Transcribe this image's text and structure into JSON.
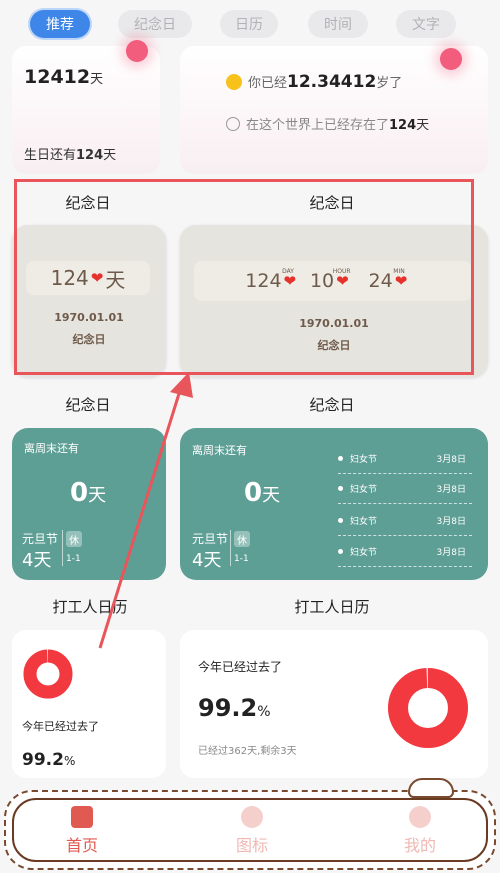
{
  "tabs": [
    {
      "label": "推荐",
      "active": true
    },
    {
      "label": "纪念日",
      "active": false
    },
    {
      "label": "日历",
      "active": false
    },
    {
      "label": "时间",
      "active": false
    },
    {
      "label": "文字",
      "active": false
    }
  ],
  "top_left_card": {
    "days_value": "12412",
    "days_unit": "天",
    "birthday_prefix": "生日还有",
    "birthday_value": "124",
    "birthday_unit": "天"
  },
  "top_right_card": {
    "age_prefix": "你已经",
    "age_value": "12.34412",
    "age_unit": "岁了",
    "exist_prefix": "在这个世界上已经存在了",
    "exist_value": "124",
    "exist_unit": "天"
  },
  "anniversary_titles": [
    "纪念日",
    "纪念日"
  ],
  "anniv_small": {
    "days": "124",
    "unit": "天",
    "date": "1970.01.01",
    "name": "纪念日"
  },
  "anniv_large": {
    "days": "124",
    "days_sup": "DAY",
    "hours": "10",
    "hours_sup": "HOUR",
    "mins": "24",
    "mins_sup": "MIN",
    "date": "1970.01.01",
    "name": "纪念日"
  },
  "anniversary_titles_2": [
    "纪念日",
    "纪念日"
  ],
  "weekend_small": {
    "title": "离周末还有",
    "value": "0",
    "unit": "天",
    "holiday": "元旦节",
    "holiday_days": "4天",
    "rest": "休",
    "holiday_date": "1-1"
  },
  "weekend_large": {
    "title": "离周末还有",
    "value": "0",
    "unit": "天",
    "holiday": "元旦节",
    "holiday_days": "4天",
    "rest": "休",
    "holiday_date": "1-1",
    "list": [
      {
        "name": "妇女节",
        "date": "3月8日"
      },
      {
        "name": "妇女节",
        "date": "3月8日"
      },
      {
        "name": "妇女节",
        "date": "3月8日"
      },
      {
        "name": "妇女节",
        "date": "3月8日"
      }
    ]
  },
  "worker_titles": [
    "打工人日历",
    "打工人日历"
  ],
  "year_small": {
    "label": "今年已经过去了",
    "value": "99.2",
    "unit": "%",
    "progress": 0.992
  },
  "year_large": {
    "label": "今年已经过去了",
    "value": "99.2",
    "unit": "%",
    "detail": "已经过362天,剩余3天",
    "progress": 0.992
  },
  "bottom_nav": [
    {
      "label": "首页",
      "active": true
    },
    {
      "label": "图标",
      "active": false
    },
    {
      "label": "我的",
      "active": false
    }
  ],
  "colors": {
    "accent_blue": "#3e86e8",
    "teal": "#5e9f95",
    "ring_red": "#f2393f",
    "highlight_red": "#e8555a",
    "nav_active": "#e05a52",
    "nav_inactive": "#f0b8b4"
  }
}
